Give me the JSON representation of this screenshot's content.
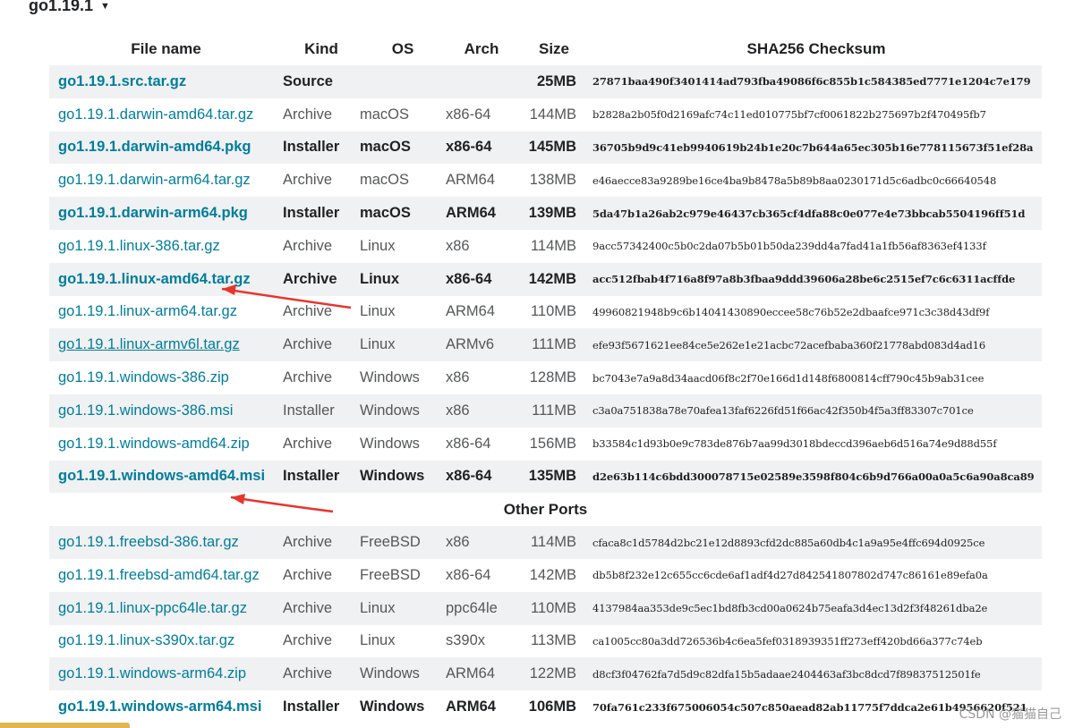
{
  "version": {
    "title": "go1.19.1",
    "caret": "▼"
  },
  "table": {
    "headers": {
      "file_name": "File name",
      "kind": "Kind",
      "os": "OS",
      "arch": "Arch",
      "size": "Size",
      "checksum": "SHA256 Checksum"
    },
    "rows": [
      {
        "file": "go1.19.1.src.tar.gz",
        "kind": "Source",
        "os": "",
        "arch": "",
        "size": "25MB",
        "checksum": "27871baa490f3401414ad793fba49086f6c855b1c584385ed7771e1204c7e179",
        "highlight": true
      },
      {
        "file": "go1.19.1.darwin-amd64.tar.gz",
        "kind": "Archive",
        "os": "macOS",
        "arch": "x86-64",
        "size": "144MB",
        "checksum": "b2828a2b05f0d2169afc74c11ed010775bf7cf0061822b275697b2f470495fb7",
        "highlight": false
      },
      {
        "file": "go1.19.1.darwin-amd64.pkg",
        "kind": "Installer",
        "os": "macOS",
        "arch": "x86-64",
        "size": "145MB",
        "checksum": "36705b9d9c41eb9940619b24b1e20c7b644a65ec305b16e778115673f51ef28a",
        "highlight": true
      },
      {
        "file": "go1.19.1.darwin-arm64.tar.gz",
        "kind": "Archive",
        "os": "macOS",
        "arch": "ARM64",
        "size": "138MB",
        "checksum": "e46aecce83a9289be16ce4ba9b8478a5b89b8aa0230171d5c6adbc0c66640548",
        "highlight": false
      },
      {
        "file": "go1.19.1.darwin-arm64.pkg",
        "kind": "Installer",
        "os": "macOS",
        "arch": "ARM64",
        "size": "139MB",
        "checksum": "5da47b1a26ab2c979e46437cb365cf4dfa88c0e077e4e73bbcab5504196ff51d",
        "highlight": true
      },
      {
        "file": "go1.19.1.linux-386.tar.gz",
        "kind": "Archive",
        "os": "Linux",
        "arch": "x86",
        "size": "114MB",
        "checksum": "9acc57342400c5b0c2da07b5b01b50da239dd4a7fad41a1fb56af8363ef4133f",
        "highlight": false
      },
      {
        "file": "go1.19.1.linux-amd64.tar.gz",
        "kind": "Archive",
        "os": "Linux",
        "arch": "x86-64",
        "size": "142MB",
        "checksum": "acc512fbab4f716a8f97a8b3fbaa9ddd39606a28be6c2515ef7c6c6311acffde",
        "highlight": true
      },
      {
        "file": "go1.19.1.linux-arm64.tar.gz",
        "kind": "Archive",
        "os": "Linux",
        "arch": "ARM64",
        "size": "110MB",
        "checksum": "49960821948b9c6b14041430890eccee58c76b52e2dbaafce971c3c38d43df9f",
        "highlight": false
      },
      {
        "file": "go1.19.1.linux-armv6l.tar.gz",
        "kind": "Archive",
        "os": "Linux",
        "arch": "ARMv6",
        "size": "111MB",
        "checksum": "efe93f5671621ee84ce5e262e1e21acbc72acefbaba360f21778abd083d4ad16",
        "highlight": false,
        "underlined": true
      },
      {
        "file": "go1.19.1.windows-386.zip",
        "kind": "Archive",
        "os": "Windows",
        "arch": "x86",
        "size": "128MB",
        "checksum": "bc7043e7a9a8d34aacd06f8c2f70e166d1d148f6800814cff790c45b9ab31cee",
        "highlight": false
      },
      {
        "file": "go1.19.1.windows-386.msi",
        "kind": "Installer",
        "os": "Windows",
        "arch": "x86",
        "size": "111MB",
        "checksum": "c3a0a751838a78e70afea13faf6226fd51f66ac42f350b4f5a3ff83307c701ce",
        "highlight": false
      },
      {
        "file": "go1.19.1.windows-amd64.zip",
        "kind": "Archive",
        "os": "Windows",
        "arch": "x86-64",
        "size": "156MB",
        "checksum": "b33584c1d93b0e9c783de876b7aa99d3018bdeccd396aeb6d516a74e9d88d55f",
        "highlight": false
      },
      {
        "file": "go1.19.1.windows-amd64.msi",
        "kind": "Installer",
        "os": "Windows",
        "arch": "x86-64",
        "size": "135MB",
        "checksum": "d2e63b114c6bdd300078715e02589e3598f804c6b9d766a00a0a5c6a90a8ca89",
        "highlight": true
      }
    ],
    "other_ports_label": "Other Ports",
    "other_rows": [
      {
        "file": "go1.19.1.freebsd-386.tar.gz",
        "kind": "Archive",
        "os": "FreeBSD",
        "arch": "x86",
        "size": "114MB",
        "checksum": "cfaca8c1d5784d2bc21e12d8893cfd2dc885a60db4c1a9a95e4ffc694d0925ce",
        "highlight": false
      },
      {
        "file": "go1.19.1.freebsd-amd64.tar.gz",
        "kind": "Archive",
        "os": "FreeBSD",
        "arch": "x86-64",
        "size": "142MB",
        "checksum": "db5b8f232e12c655cc6cde6af1adf4d27d842541807802d747c86161e89efa0a",
        "highlight": false
      },
      {
        "file": "go1.19.1.linux-ppc64le.tar.gz",
        "kind": "Archive",
        "os": "Linux",
        "arch": "ppc64le",
        "size": "110MB",
        "checksum": "4137984aa353de9c5ec1bd8fb3cd00a0624b75eafa3d4ec13d2f3f48261dba2e",
        "highlight": false
      },
      {
        "file": "go1.19.1.linux-s390x.tar.gz",
        "kind": "Archive",
        "os": "Linux",
        "arch": "s390x",
        "size": "113MB",
        "checksum": "ca1005cc80a3dd726536b4c6ea5fef0318939351ff273eff420bd66a377c74eb",
        "highlight": false
      },
      {
        "file": "go1.19.1.windows-arm64.zip",
        "kind": "Archive",
        "os": "Windows",
        "arch": "ARM64",
        "size": "122MB",
        "checksum": "d8cf3f04762fa7d5d9c82dfa15b5adaae2404463af3bc8dcd7f89837512501fe",
        "highlight": false
      },
      {
        "file": "go1.19.1.windows-arm64.msi",
        "kind": "Installer",
        "os": "Windows",
        "arch": "ARM64",
        "size": "106MB",
        "checksum": "70fa761c233f675006054c507c850aead82ab11775f7ddca2e61b4956620f521",
        "highlight": true
      }
    ]
  },
  "annotations": {
    "arrow_color": "#e8352c"
  },
  "watermark": "CSDN @猫猫自己"
}
